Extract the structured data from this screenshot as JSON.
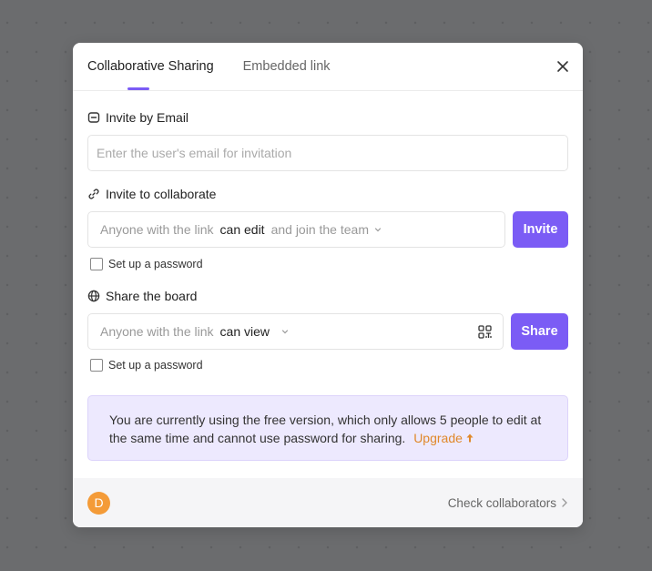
{
  "modal": {
    "tabs": [
      {
        "label": "Collaborative Sharing",
        "active": true
      },
      {
        "label": "Embedded link",
        "active": false
      }
    ],
    "accent_color": "#7b5cf5"
  },
  "invite_email": {
    "title": "Invite by Email",
    "icon": "mail-icon",
    "input_value": "",
    "input_placeholder": "Enter the user's email for invitation"
  },
  "invite_collab": {
    "title": "Invite to collaborate",
    "icon": "link-icon",
    "select_prefix": "Anyone with the link",
    "permission": "can edit",
    "select_suffix": "and join the team",
    "button_label": "Invite",
    "password_label": "Set up a password",
    "password_checked": false
  },
  "share_board": {
    "title": "Share the board",
    "icon": "globe-icon",
    "select_prefix": "Anyone with the link",
    "permission": "can view",
    "qr_icon": "qr-code-icon",
    "button_label": "Share",
    "password_label": "Set up a password",
    "password_checked": false
  },
  "notice": {
    "text": "You are currently using the free version, which only allows 5 people to edit at the same time and cannot use password for sharing.",
    "upgrade_label": "Upgrade",
    "upgrade_color": "#e0882a"
  },
  "footer": {
    "avatar_initial": "D",
    "avatar_color": "#f49b38",
    "check_collaborators_label": "Check collaborators"
  }
}
